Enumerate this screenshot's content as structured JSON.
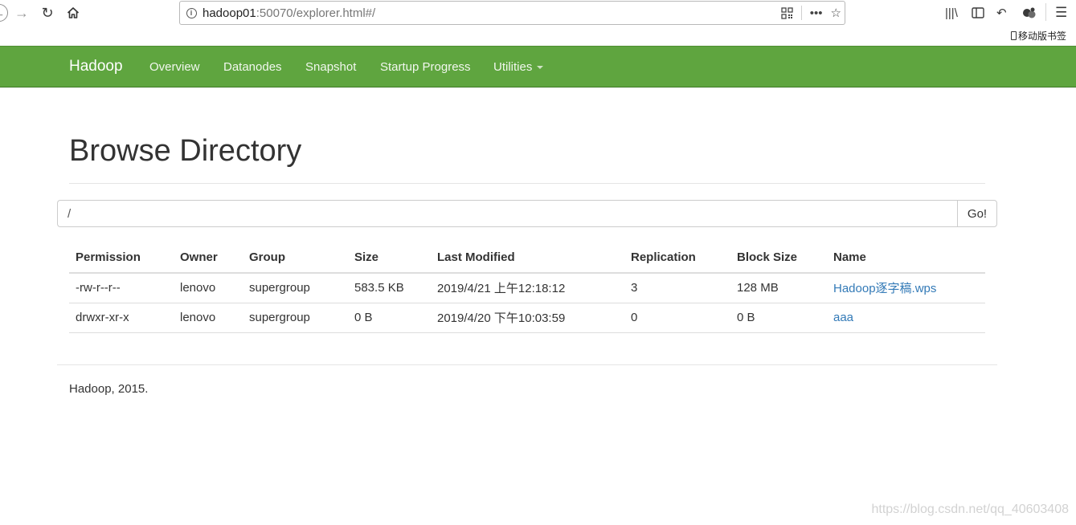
{
  "browser": {
    "url_host": "hadoop01",
    "url_rest": ":50070/explorer.html#/",
    "mobile_bookmarks_label": "移动版书签"
  },
  "navbar": {
    "brand": "Hadoop",
    "items": [
      {
        "label": "Overview"
      },
      {
        "label": "Datanodes"
      },
      {
        "label": "Snapshot"
      },
      {
        "label": "Startup Progress"
      },
      {
        "label": "Utilities"
      }
    ],
    "background_color": "#5fa53f"
  },
  "page": {
    "title": "Browse Directory",
    "path_value": "/",
    "go_label": "Go!"
  },
  "table": {
    "headers": [
      "Permission",
      "Owner",
      "Group",
      "Size",
      "Last Modified",
      "Replication",
      "Block Size",
      "Name"
    ],
    "rows": [
      [
        "-rw-r--r--",
        "lenovo",
        "supergroup",
        "583.5 KB",
        "2019/4/21 上午12:18:12",
        "3",
        "128 MB",
        "Hadoop逐字稿.wps"
      ],
      [
        "drwxr-xr-x",
        "lenovo",
        "supergroup",
        "0 B",
        "2019/4/20 下午10:03:59",
        "0",
        "0 B",
        "aaa"
      ]
    ],
    "link_color": "#337ab7"
  },
  "footer": {
    "text": "Hadoop, 2015."
  },
  "watermark": "https://blog.csdn.net/qq_40603408"
}
